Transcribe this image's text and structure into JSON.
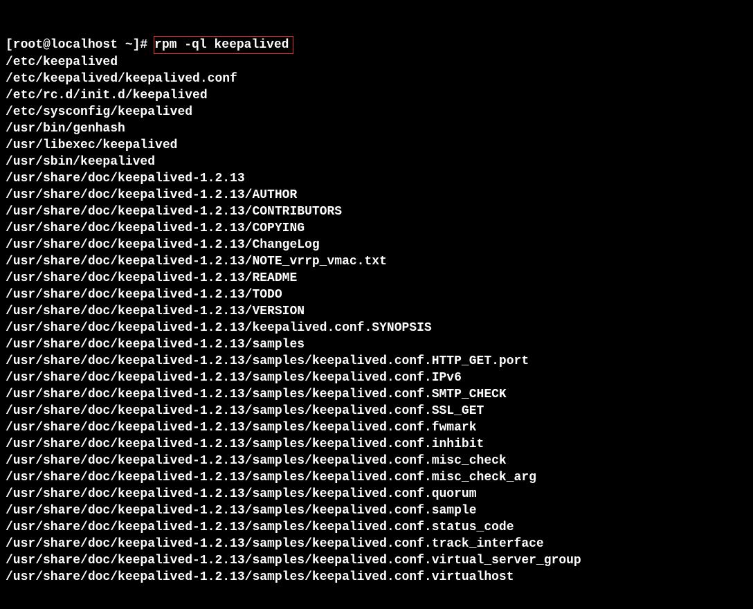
{
  "prompt": "[root@localhost ~]#",
  "command": "rpm -ql keepalived",
  "lines": [
    "/etc/keepalived",
    "/etc/keepalived/keepalived.conf",
    "/etc/rc.d/init.d/keepalived",
    "/etc/sysconfig/keepalived",
    "/usr/bin/genhash",
    "/usr/libexec/keepalived",
    "/usr/sbin/keepalived",
    "/usr/share/doc/keepalived-1.2.13",
    "/usr/share/doc/keepalived-1.2.13/AUTHOR",
    "/usr/share/doc/keepalived-1.2.13/CONTRIBUTORS",
    "/usr/share/doc/keepalived-1.2.13/COPYING",
    "/usr/share/doc/keepalived-1.2.13/ChangeLog",
    "/usr/share/doc/keepalived-1.2.13/NOTE_vrrp_vmac.txt",
    "/usr/share/doc/keepalived-1.2.13/README",
    "/usr/share/doc/keepalived-1.2.13/TODO",
    "/usr/share/doc/keepalived-1.2.13/VERSION",
    "/usr/share/doc/keepalived-1.2.13/keepalived.conf.SYNOPSIS",
    "/usr/share/doc/keepalived-1.2.13/samples",
    "/usr/share/doc/keepalived-1.2.13/samples/keepalived.conf.HTTP_GET.port",
    "/usr/share/doc/keepalived-1.2.13/samples/keepalived.conf.IPv6",
    "/usr/share/doc/keepalived-1.2.13/samples/keepalived.conf.SMTP_CHECK",
    "/usr/share/doc/keepalived-1.2.13/samples/keepalived.conf.SSL_GET",
    "/usr/share/doc/keepalived-1.2.13/samples/keepalived.conf.fwmark",
    "/usr/share/doc/keepalived-1.2.13/samples/keepalived.conf.inhibit",
    "/usr/share/doc/keepalived-1.2.13/samples/keepalived.conf.misc_check",
    "/usr/share/doc/keepalived-1.2.13/samples/keepalived.conf.misc_check_arg",
    "/usr/share/doc/keepalived-1.2.13/samples/keepalived.conf.quorum",
    "/usr/share/doc/keepalived-1.2.13/samples/keepalived.conf.sample",
    "/usr/share/doc/keepalived-1.2.13/samples/keepalived.conf.status_code",
    "/usr/share/doc/keepalived-1.2.13/samples/keepalived.conf.track_interface",
    "/usr/share/doc/keepalived-1.2.13/samples/keepalived.conf.virtual_server_group",
    "/usr/share/doc/keepalived-1.2.13/samples/keepalived.conf.virtualhost"
  ]
}
